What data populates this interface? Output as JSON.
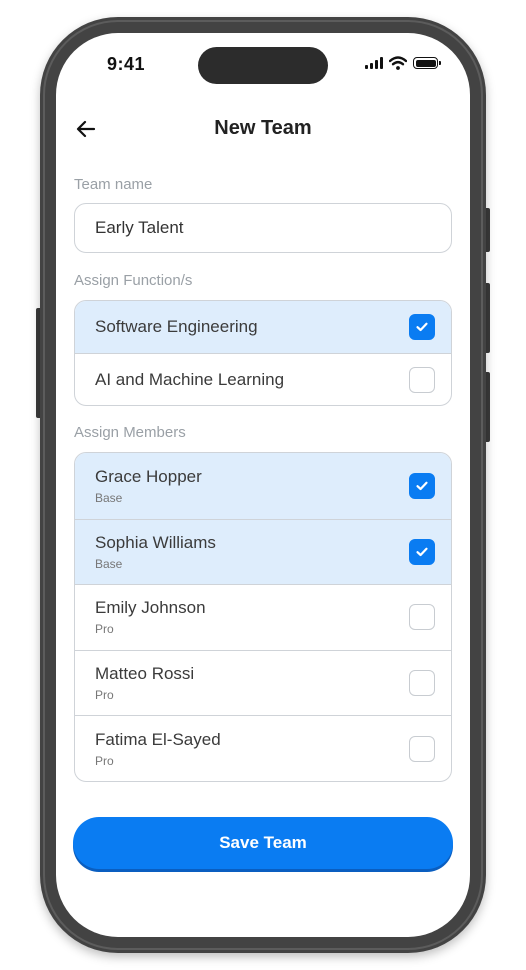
{
  "status_bar": {
    "time": "9:41"
  },
  "header": {
    "title": "New Team"
  },
  "team_name": {
    "label": "Team name",
    "value": "Early Talent"
  },
  "functions": {
    "label": "Assign Function/s",
    "items": [
      {
        "label": "Software Engineering",
        "checked": true
      },
      {
        "label": "AI and Machine Learning",
        "checked": false
      }
    ]
  },
  "members": {
    "label": "Assign Members",
    "items": [
      {
        "name": "Grace Hopper",
        "plan": "Base",
        "checked": true
      },
      {
        "name": "Sophia Williams",
        "plan": "Base",
        "checked": true
      },
      {
        "name": "Emily Johnson",
        "plan": "Pro",
        "checked": false
      },
      {
        "name": "Matteo Rossi",
        "plan": "Pro",
        "checked": false
      },
      {
        "name": "Fatima El-Sayed",
        "plan": "Pro",
        "checked": false
      }
    ]
  },
  "save_button": {
    "label": "Save Team"
  },
  "colors": {
    "accent": "#0a7cf2",
    "selected_row": "#deedfc",
    "frame": "#434343"
  }
}
